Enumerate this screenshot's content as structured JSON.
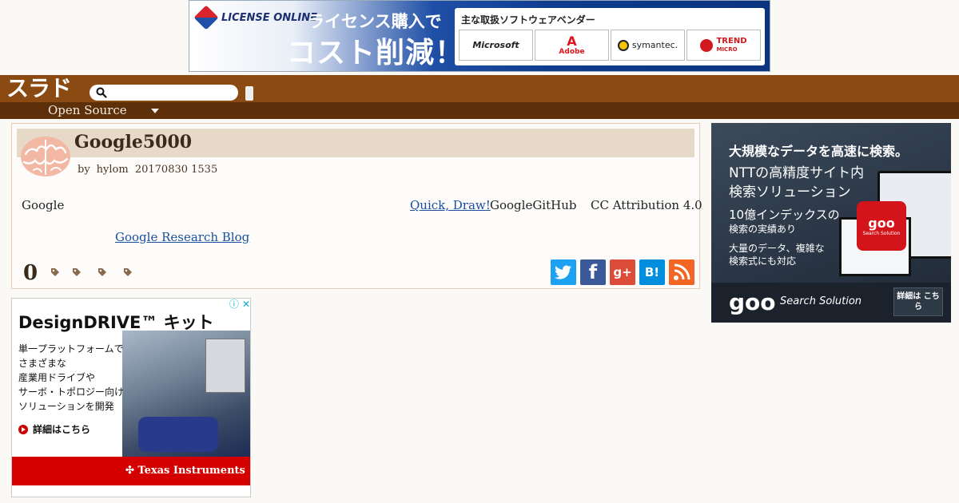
{
  "top_ad": {
    "brand": "LICENSE ONLINE",
    "headline_1": "ライセンス購入で",
    "headline_2": "コスト削減！",
    "vendor_title": "主な取扱ソフトウェアベンダー",
    "vendors": [
      "Microsoft",
      "Adobe",
      "symantec.",
      "TREND"
    ],
    "adobe_mark": "A",
    "trend_sub": "MICRO"
  },
  "header": {
    "logo": "スラド",
    "search_placeholder": "",
    "nav_topic": "Open Source"
  },
  "article": {
    "title": "Google5000",
    "by_label": "by",
    "author": "hylom",
    "timestamp": "20170830 1535",
    "body_text_1": "Google",
    "link_quickdraw": "Quick, Draw!",
    "body_text_2": "GoogleGitHub",
    "license_text": "CC Attribution 4.0",
    "link_blog": "Google Research Blog",
    "comment_count": "0"
  },
  "share": {
    "twitter": "t",
    "facebook": "f",
    "googleplus": "g+",
    "hatena": "B!",
    "rss": "rss",
    "colors": {
      "twitter": "#1da1f2",
      "facebook": "#3b5998",
      "googleplus": "#dd4b39",
      "hatena": "#008fde",
      "rss": "#f26522"
    }
  },
  "right_ad": {
    "line1": "大規模なデータを高速に検索。",
    "line2": "NTTの高精度サイト内",
    "line3": "検索ソリューション",
    "line4": "10億インデックスの",
    "line5": "検索の実績あり",
    "line6": "大量のデータ、複雑な",
    "line7": "検索式にも対応",
    "badge_logo": "goo",
    "badge_sub": "Search Solution",
    "footer_logo": "goo",
    "footer_sub": "Search Solution",
    "detail_button": "詳細は こちら"
  },
  "left_ad": {
    "title": "DesignDRIVE™ キット",
    "lines": [
      "単一プラットフォームで",
      "さまざまな",
      "産業用ドライブや",
      "サーボ・トポロジー向け",
      "ソリューションを開発"
    ],
    "link": "詳細はこちら",
    "sponsor": "✣ Texas Instruments",
    "adchoice_info": "ⓘ",
    "adchoice_close": "✕"
  },
  "colors": {
    "header_brown": "#8a4a12",
    "nav_dark_brown": "#5e300a",
    "title_bar": "#e6d9c8",
    "link_blue": "#1a4fa0"
  }
}
